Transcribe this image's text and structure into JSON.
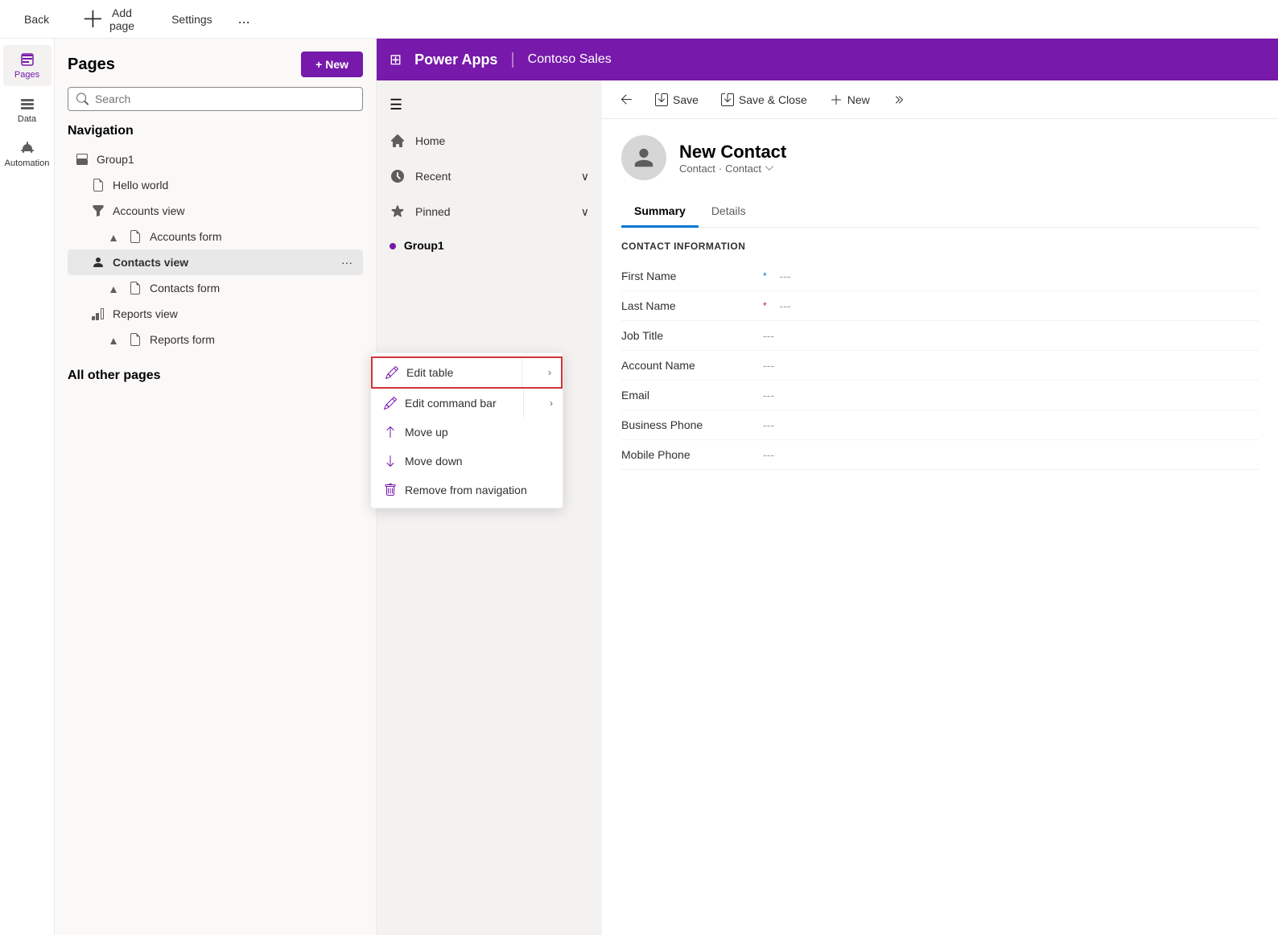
{
  "topBar": {
    "backLabel": "Back",
    "addPageLabel": "Add page",
    "settingsLabel": "Settings",
    "ellipsis": "..."
  },
  "iconSidebar": {
    "items": [
      {
        "id": "pages",
        "label": "Pages",
        "active": true
      },
      {
        "id": "data",
        "label": "Data",
        "active": false
      },
      {
        "id": "automation",
        "label": "Automation",
        "active": false
      }
    ]
  },
  "pagesPanel": {
    "title": "Pages",
    "newBtnLabel": "+ New",
    "searchPlaceholder": "Search",
    "navigation": {
      "sectionTitle": "Navigation",
      "items": [
        {
          "id": "group1",
          "label": "Group1",
          "type": "group",
          "indent": 0
        },
        {
          "id": "hello-world",
          "label": "Hello world",
          "type": "page",
          "indent": 1
        },
        {
          "id": "accounts-view",
          "label": "Accounts view",
          "type": "view",
          "indent": 1
        },
        {
          "id": "accounts-form",
          "label": "Accounts form",
          "type": "form",
          "indent": 2
        },
        {
          "id": "contacts-view",
          "label": "Contacts view",
          "type": "view",
          "indent": 1,
          "active": true
        },
        {
          "id": "contacts-form",
          "label": "Contacts form",
          "type": "form",
          "indent": 2
        },
        {
          "id": "reports-view",
          "label": "Reports view",
          "type": "view",
          "indent": 1
        },
        {
          "id": "reports-form",
          "label": "Reports form",
          "type": "form",
          "indent": 2
        }
      ]
    },
    "allOtherPages": "All other pages"
  },
  "contextMenu": {
    "items": [
      {
        "id": "edit-table",
        "label": "Edit table",
        "hasSubMenu": true,
        "highlighted": true
      },
      {
        "id": "edit-command-bar",
        "label": "Edit command bar",
        "hasSubMenu": true
      },
      {
        "id": "move-up",
        "label": "Move up",
        "hasSubMenu": false
      },
      {
        "id": "move-down",
        "label": "Move down",
        "hasSubMenu": false
      },
      {
        "id": "remove-from-navigation",
        "label": "Remove from navigation",
        "hasSubMenu": false
      }
    ]
  },
  "appHeader": {
    "appTitle": "Power Apps",
    "appName": "Contoso Sales"
  },
  "appSidebar": {
    "items": [
      {
        "id": "home",
        "label": "Home"
      },
      {
        "id": "recent",
        "label": "Recent",
        "hasChevron": true
      },
      {
        "id": "pinned",
        "label": "Pinned",
        "hasChevron": true
      }
    ],
    "groupLabel": "Group1"
  },
  "formToolbar": {
    "backLabel": "",
    "saveLabel": "Save",
    "saveCloseLabel": "Save & Close",
    "newLabel": "New"
  },
  "contactForm": {
    "title": "New Contact",
    "subtitle1": "Contact",
    "subtitle2": "Contact",
    "tabs": [
      {
        "id": "summary",
        "label": "Summary",
        "active": true
      },
      {
        "id": "details",
        "label": "Details",
        "active": false
      }
    ],
    "sectionHeader": "CONTACT INFORMATION",
    "fields": [
      {
        "id": "first-name",
        "label": "First Name",
        "required": "blue",
        "value": "---"
      },
      {
        "id": "last-name",
        "label": "Last Name",
        "required": "red",
        "value": "---"
      },
      {
        "id": "job-title",
        "label": "Job Title",
        "required": "",
        "value": "---"
      },
      {
        "id": "account-name",
        "label": "Account Name",
        "required": "",
        "value": "---"
      },
      {
        "id": "email",
        "label": "Email",
        "required": "",
        "value": "---"
      },
      {
        "id": "business-phone",
        "label": "Business Phone",
        "required": "",
        "value": "---"
      },
      {
        "id": "mobile-phone",
        "label": "Mobile Phone",
        "required": "",
        "value": "---"
      }
    ]
  }
}
